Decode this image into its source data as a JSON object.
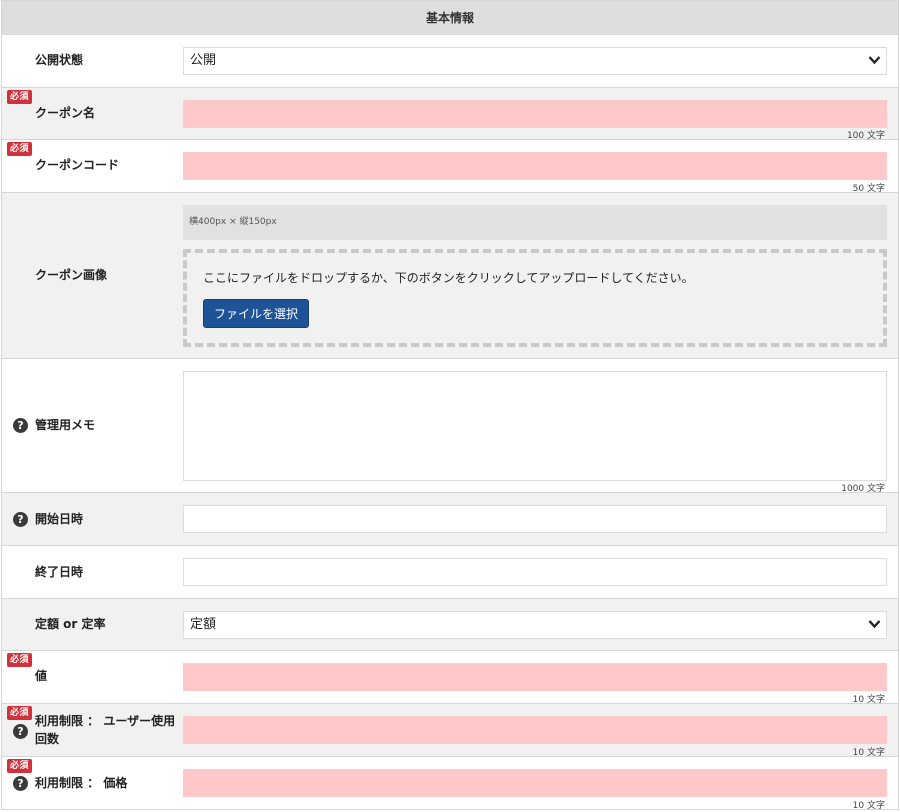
{
  "header": {
    "title": "基本情報"
  },
  "badges": {
    "required": "必須",
    "help": "?"
  },
  "rows": {
    "status": {
      "label": "公開状態",
      "value": "公開"
    },
    "coupon_name": {
      "label": "クーポン名",
      "counter": "100 文字"
    },
    "coupon_code": {
      "label": "クーポンコード",
      "counter": "50 文字"
    },
    "coupon_image": {
      "label": "クーポン画像",
      "size_hint": "横400px × 縦150px",
      "drop_text": "ここにファイルをドロップするか、下のボタンをクリックしてアップロードしてください。",
      "button": "ファイルを選択"
    },
    "memo": {
      "label": "管理用メモ",
      "counter": "1000 文字"
    },
    "start": {
      "label": "開始日時"
    },
    "end": {
      "label": "終了日時"
    },
    "type": {
      "label": "定額 or 定率",
      "value": "定額"
    },
    "value": {
      "label": "値",
      "counter": "10 文字"
    },
    "user_limit": {
      "label_line1": "利用制限 ： ユーザー使用",
      "label_line2": "回数",
      "counter": "10 文字"
    },
    "price_limit": {
      "label": "利用制限 ： 価格",
      "counter": "10 文字"
    }
  }
}
